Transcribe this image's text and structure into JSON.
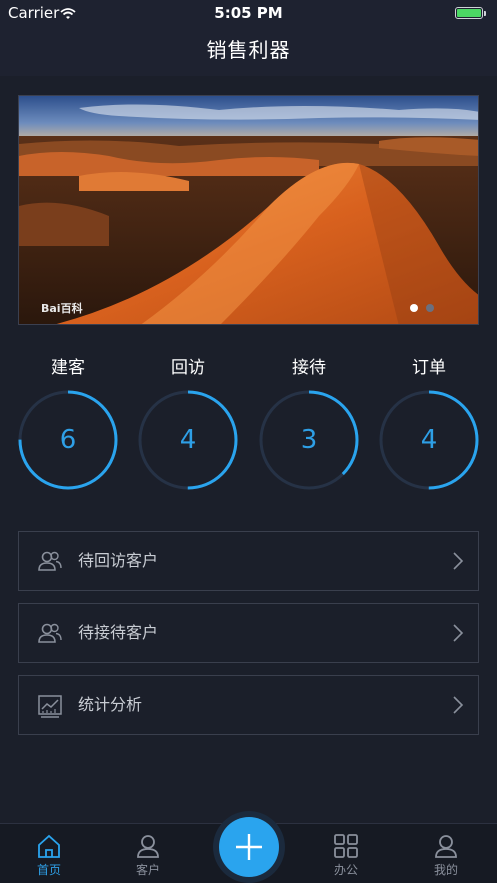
{
  "status_bar": {
    "carrier": "Carrier",
    "time": "5:05 PM",
    "battery_level": 1.0
  },
  "nav": {
    "title": "销售利器"
  },
  "banner": {
    "watermark": "Bai百科",
    "page_count": 2,
    "active_page": 1
  },
  "stats": [
    {
      "label": "建客",
      "value": "6",
      "progress": 0.75
    },
    {
      "label": "回访",
      "value": "4",
      "progress": 0.5
    },
    {
      "label": "接待",
      "value": "3",
      "progress": 0.375
    },
    {
      "label": "订单",
      "value": "4",
      "progress": 0.5
    }
  ],
  "colors": {
    "accent": "#2aa4ee",
    "ring_track": "#263246",
    "background": "#1b1f2a"
  },
  "menu": [
    {
      "label": "待回访客户",
      "icon": "users-icon"
    },
    {
      "label": "待接待客户",
      "icon": "users-icon"
    },
    {
      "label": "统计分析",
      "icon": "chart-icon"
    }
  ],
  "tabbar": {
    "items": [
      {
        "label": "首页",
        "icon": "home-icon",
        "active": true
      },
      {
        "label": "客户",
        "icon": "person-icon",
        "active": false
      },
      {
        "label": "办公",
        "icon": "grid-icon",
        "active": false
      },
      {
        "label": "我的",
        "icon": "person-icon",
        "active": false
      }
    ],
    "center_action": "plus-icon"
  }
}
